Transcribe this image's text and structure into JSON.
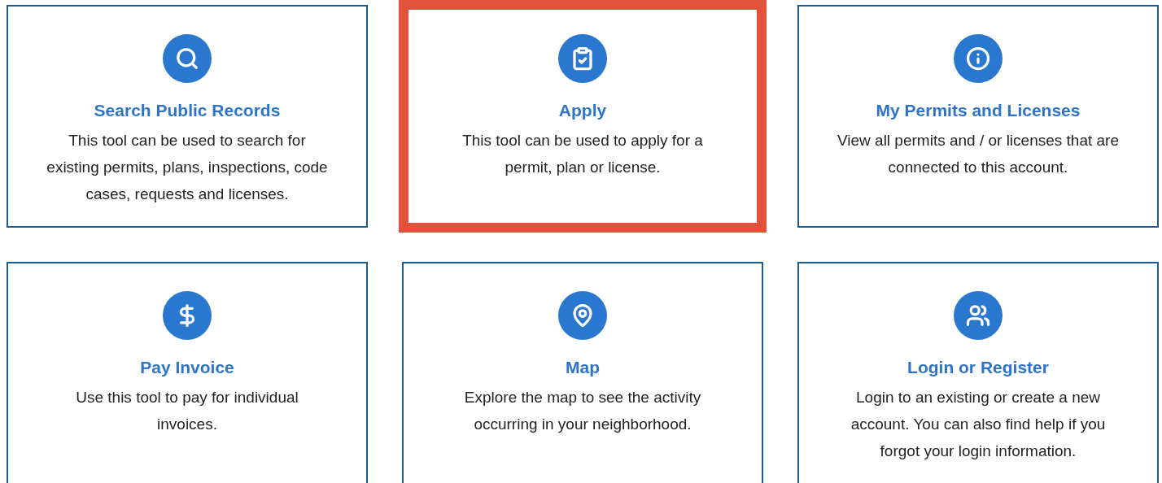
{
  "cards": [
    {
      "title": "Search Public Records",
      "description": "This tool can be used to search for existing permits, plans, inspections, code cases, requests and licenses.",
      "selected": false
    },
    {
      "title": "Apply",
      "description": "This tool can be used to apply for a permit, plan or license.",
      "selected": true
    },
    {
      "title": "My Permits and Licenses",
      "description": "View all permits and / or licenses that are connected to this account.",
      "selected": false
    },
    {
      "title": "Pay Invoice",
      "description": "Use this tool to pay for individual invoices.",
      "selected": false
    },
    {
      "title": "Map",
      "description": "Explore the map to see the activity occurring in your neighborhood.",
      "selected": false
    },
    {
      "title": "Login or Register",
      "description": "Login to an existing or create a new account. You can also find help if you forgot your login information.",
      "selected": false
    }
  ]
}
